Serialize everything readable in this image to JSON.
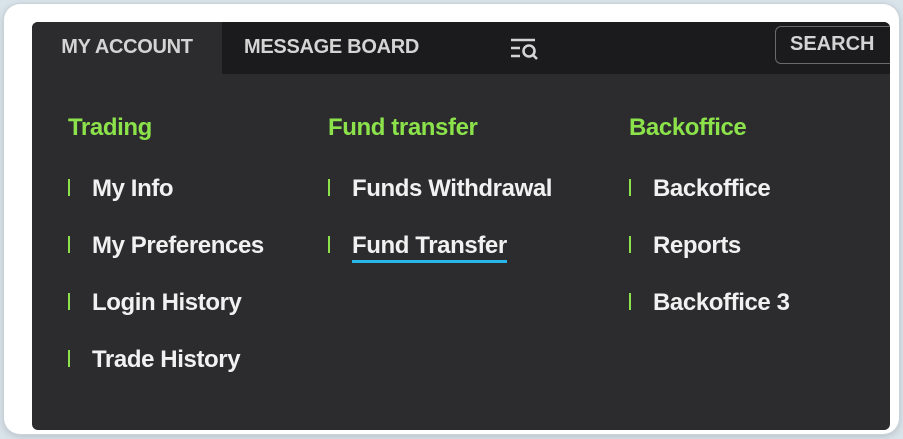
{
  "tabs": [
    {
      "label": "MY ACCOUNT",
      "active": true
    },
    {
      "label": "MESSAGE BOARD",
      "active": false
    }
  ],
  "search": {
    "label": "SEARCH"
  },
  "icons": {
    "filter": "filter-search-icon"
  },
  "colors": {
    "heading": "#8be24a",
    "underline": "#29b6e8",
    "panel": "#2c2c2e",
    "tabbar": "#1b1b1d"
  },
  "columns": [
    {
      "heading": "Trading",
      "items": [
        "My Info",
        "My Preferences",
        "Login History",
        "Trade History"
      ]
    },
    {
      "heading": "Fund transfer",
      "items": [
        "Funds Withdrawal",
        "Fund Transfer"
      ],
      "hovered_item": "Fund Transfer"
    },
    {
      "heading": "Backoffice",
      "items": [
        "Backoffice",
        "Reports",
        "Backoffice 3"
      ]
    }
  ]
}
